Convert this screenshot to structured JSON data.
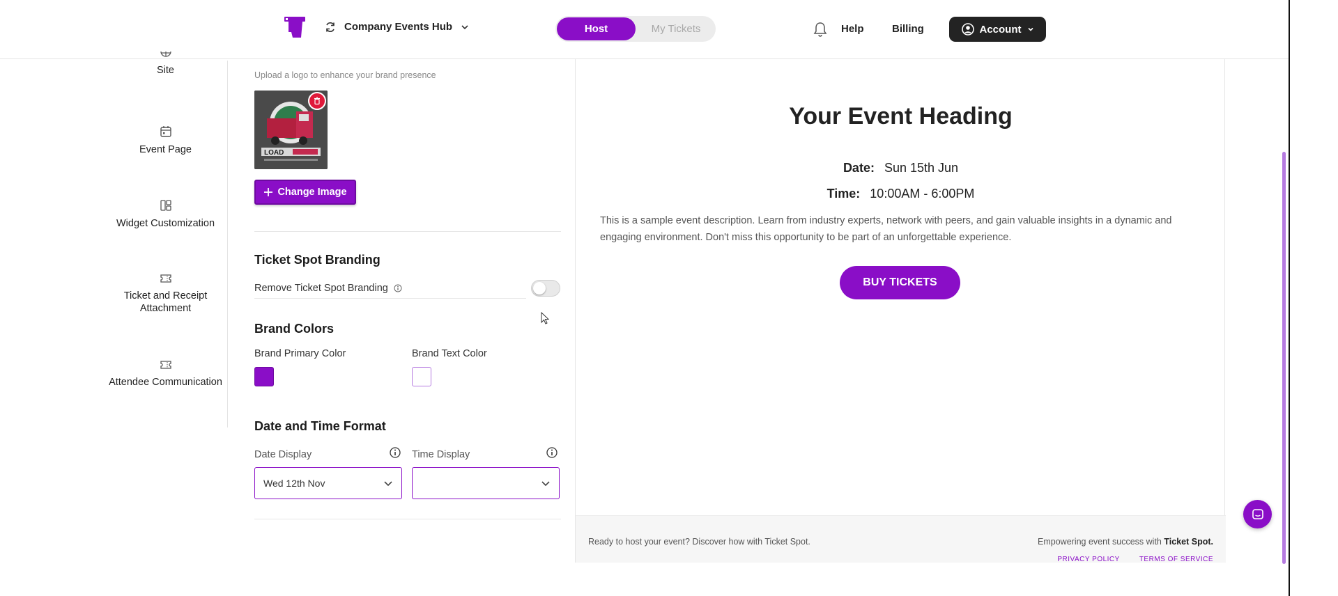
{
  "header": {
    "org_name": "Company Events Hub",
    "toggle": {
      "host": "Host",
      "my_tickets": "My Tickets",
      "active": "Host"
    },
    "help": "Help",
    "billing": "Billing",
    "account": "Account"
  },
  "sidebar": {
    "items": [
      {
        "label": "Site",
        "icon": "globe-icon"
      },
      {
        "label": "Event Page",
        "icon": "calendar-icon"
      },
      {
        "label": "Widget Customization",
        "icon": "layout-icon"
      },
      {
        "label": "Ticket and Receipt Attachment",
        "icon": "ticket-icon"
      },
      {
        "label": "Attendee Communication",
        "icon": "ticket-icon"
      }
    ]
  },
  "settings": {
    "logo_hint": "Upload a logo to enhance your brand presence",
    "logo_thumb_text": "LOAD",
    "change_image": "Change Image",
    "ticket_spot_branding": {
      "title": "Ticket Spot Branding",
      "remove_label": "Remove Ticket Spot Branding",
      "remove_enabled": false
    },
    "brand_colors": {
      "title": "Brand Colors",
      "primary_label": "Brand Primary Color",
      "primary_value": "#8A0EC7",
      "text_label": "Brand Text Color",
      "text_value": "#FFFFFF"
    },
    "date_time_format": {
      "title": "Date and Time Format",
      "date_label": "Date Display",
      "date_value": "Wed 12th Nov",
      "time_label": "Time Display",
      "time_value": ""
    }
  },
  "preview": {
    "heading": "Your Event Heading",
    "date_label": "Date:",
    "date_value": "Sun 15th Jun",
    "time_label": "Time:",
    "time_value": "10:00AM - 6:00PM",
    "description": "This is a sample event description. Learn from industry experts, network with peers, and gain valuable insights in a dynamic and engaging environment. Don't miss this opportunity to be part of an unforgettable experience.",
    "buy_button": "BUY TICKETS",
    "footer_left": "Ready to host your event? Discover how with Ticket Spot.",
    "footer_right_prefix": "Empowering event success with",
    "footer_right_brand": "Ticket Spot.",
    "links": [
      "PRIVACY POLICY",
      "TERMS OF SERVICE"
    ]
  },
  "colors": {
    "accent": "#8A0EC7",
    "account_bg": "#232323",
    "delete_badge": "#E0193A"
  }
}
